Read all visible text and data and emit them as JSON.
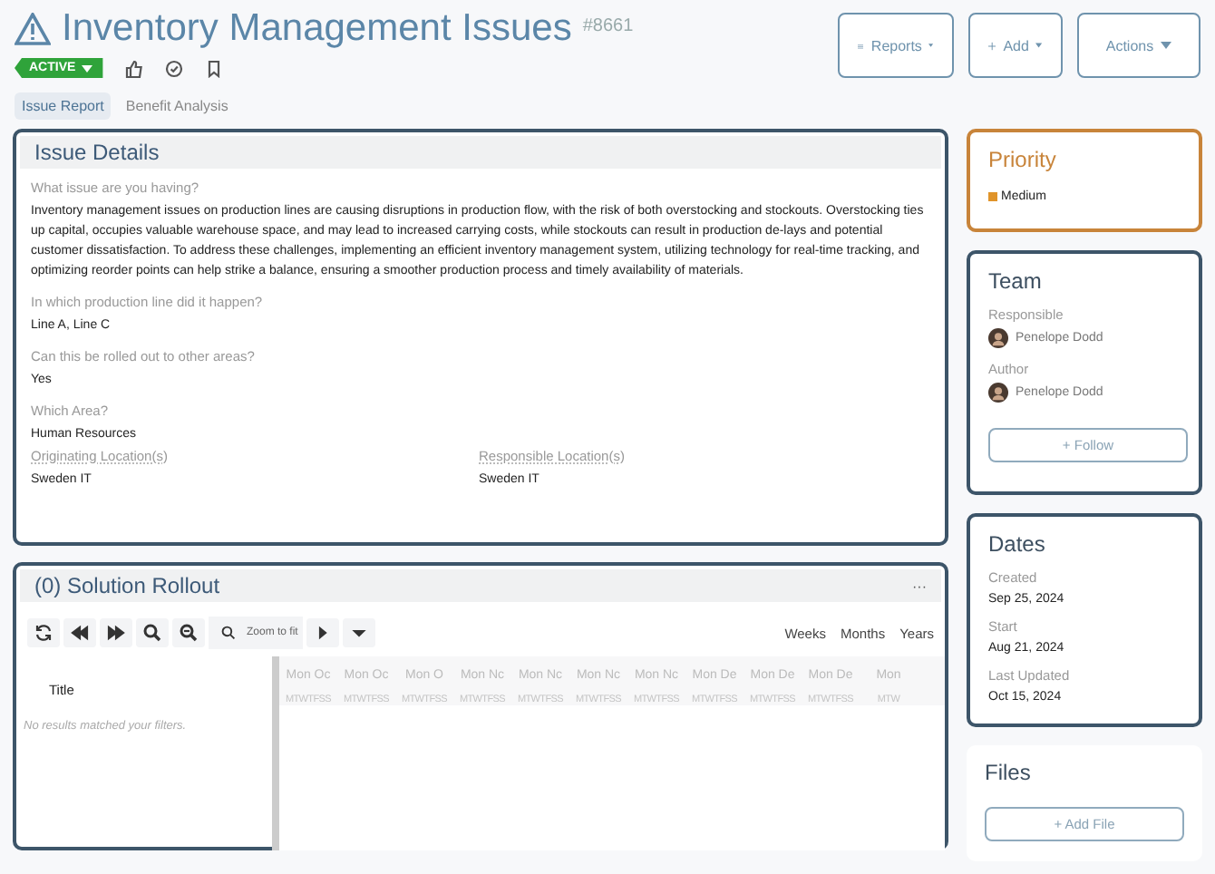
{
  "header": {
    "title": "Inventory Management Issues",
    "number": "#8661",
    "status": "ACTIVE",
    "buttons": [
      {
        "label": "Reports",
        "kind": "reports"
      },
      {
        "label": "Add",
        "kind": "add"
      },
      {
        "label": "Actions",
        "kind": "plain"
      }
    ]
  },
  "tabs": [
    {
      "label": "Issue Report",
      "selected": true
    },
    {
      "label": "Benefit Analysis",
      "selected": false
    }
  ],
  "issue_details": {
    "title": "Issue Details",
    "fields": [
      {
        "label": "What issue are you having?",
        "value": "Inventory management issues on production lines are causing disruptions in production flow, with the risk of both overstocking and stockouts. Overstocking ties up capital, occupies valuable warehouse space, and may lead to increased carrying costs, while stockouts can result in production de-lays and potential customer dissatisfaction. To address these challenges, implementing an efficient inventory management system, utilizing technology for real-time tracking, and optimizing reorder points can help strike a balance, ensuring a smoother production process and timely availability of materials."
      },
      {
        "label": "In which production line did it happen?",
        "value": "Line A, Line C"
      },
      {
        "label": "Can this be rolled out to other areas?",
        "value": "Yes"
      },
      {
        "label": "Which Area?",
        "value": "Human Resources"
      }
    ],
    "locations": [
      {
        "label": "Originating Location(s)",
        "value": "Sweden IT"
      },
      {
        "label": "Responsible Location(s)",
        "value": "Sweden IT"
      }
    ]
  },
  "solution_rollout": {
    "title": "(0) Solution Rollout",
    "menu": "···",
    "zoom_label": "Zoom to fit",
    "views": [
      "Weeks",
      "Months",
      "Years"
    ],
    "column": "Title",
    "empty": "No results matched your filters.",
    "weeks": [
      {
        "label": "Mon Oc",
        "days": "MTWTFSS"
      },
      {
        "label": "Mon Oc",
        "days": "MTWTFSS"
      },
      {
        "label": "Mon O",
        "days": "MTWTFSS"
      },
      {
        "label": "Mon Nc",
        "days": "MTWTFSS"
      },
      {
        "label": "Mon Nc",
        "days": "MTWTFSS"
      },
      {
        "label": "Mon Nc",
        "days": "MTWTFSS"
      },
      {
        "label": "Mon Nc",
        "days": "MTWTFSS"
      },
      {
        "label": "Mon De",
        "days": "MTWTFSS"
      },
      {
        "label": "Mon De",
        "days": "MTWTFSS"
      },
      {
        "label": "Mon De",
        "days": "MTWTFSS"
      },
      {
        "label": "Mon",
        "days": "MTW"
      }
    ]
  },
  "priority": {
    "title": "Priority",
    "value": "Medium",
    "color": "#e0942a"
  },
  "team": {
    "title": "Team",
    "members": [
      {
        "role": "Responsible",
        "name": "Penelope Dodd"
      },
      {
        "role": "Author",
        "name": "Penelope Dodd"
      }
    ],
    "button": "+ Follow"
  },
  "dates": {
    "title": "Dates",
    "items": [
      {
        "label": "Created",
        "value": "Sep 25, 2024"
      },
      {
        "label": "Start",
        "value": "Aug 21, 2024"
      },
      {
        "label": "Last Updated",
        "value": "Oct 15, 2024"
      }
    ]
  },
  "files": {
    "title": "Files",
    "button": "+ Add File"
  }
}
